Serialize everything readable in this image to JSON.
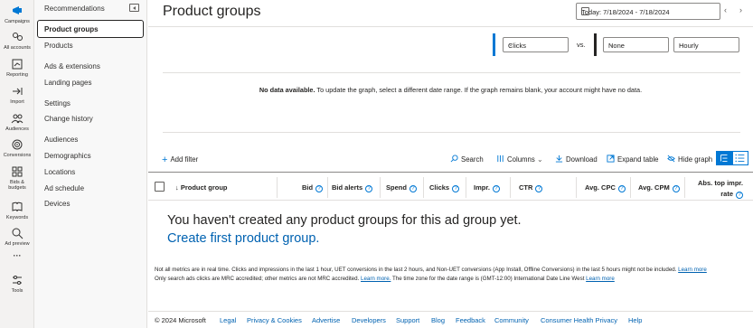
{
  "rail": {
    "items": [
      {
        "label": "Campaigns",
        "icon": "megaphone-icon"
      },
      {
        "label": "All accounts",
        "icon": "accounts-icon"
      },
      {
        "label": "Reporting",
        "icon": "reporting-icon"
      },
      {
        "label": "Import",
        "icon": "import-icon"
      },
      {
        "label": "Audiences",
        "icon": "audiences-icon"
      },
      {
        "label": "Conversions",
        "icon": "conversions-icon"
      },
      {
        "label": "Bids & budgets",
        "icon": "bids-icon"
      },
      {
        "label": "Keywords",
        "icon": "keywords-icon"
      },
      {
        "label": "Ad preview",
        "icon": "ad-preview-icon"
      },
      {
        "label": "···",
        "icon": "more-icon"
      },
      {
        "label": "Tools",
        "icon": "tools-icon"
      }
    ]
  },
  "subnav": {
    "items": [
      "Recommendations",
      "Product groups",
      "Products",
      "Ads & extensions",
      "Landing pages",
      "Settings",
      "Change history",
      "Audiences",
      "Demographics",
      "Locations",
      "Ad schedule",
      "Devices"
    ],
    "selected": "Product groups"
  },
  "header": {
    "title": "Product groups",
    "date_range": "Today: 7/18/2024 - 7/18/2024"
  },
  "graph": {
    "metric1": "Clicks",
    "vs": "vs.",
    "metric2": "None",
    "granularity": "Hourly",
    "no_data_bold": "No data available.",
    "no_data_text": " To update the graph, select a different date range. If the graph remains blank, your account might have no data."
  },
  "toolbar": {
    "add_filter": "Add filter",
    "search": "Search",
    "columns": "Columns",
    "download": "Download",
    "expand_table": "Expand table",
    "hide_graph": "Hide graph"
  },
  "table": {
    "columns": [
      "Product group",
      "Bid",
      "Bid alerts",
      "Spend",
      "Clicks",
      "Impr.",
      "CTR",
      "Avg. CPC",
      "Avg. CPM",
      "Abs. top impr.",
      "rate"
    ],
    "empty_message": "You haven't created any product groups for this ad group yet.",
    "create_link": "Create first product group."
  },
  "footnote": {
    "line1": "Not all metrics are in real time. Clicks and impressions in the last 1 hour, UET conversions in the last 2 hours, and Non-UET conversions (App Install, Offline Conversions) in the last 5 hours might not be included. ",
    "line1_link": "Learn more",
    "line2": "Only search ads clicks are MRC accredited; other metrics are not MRC accredited. ",
    "line2_link": "Learn more.",
    "line2b": " The time zone for the date range is (GMT-12:00) International Date Line West ",
    "line2_link2": "Learn more"
  },
  "footer": {
    "copyright": "© 2024 Microsoft",
    "links": [
      "Legal",
      "Privacy & Cookies",
      "Advertise",
      "Developers",
      "Support",
      "Blog",
      "Feedback",
      "Community",
      "Consumer Health Privacy",
      "Help"
    ]
  },
  "colors": {
    "accent": "#0078d4",
    "link": "#0062b1",
    "series1": "#0078d4",
    "series2": "#252423"
  }
}
